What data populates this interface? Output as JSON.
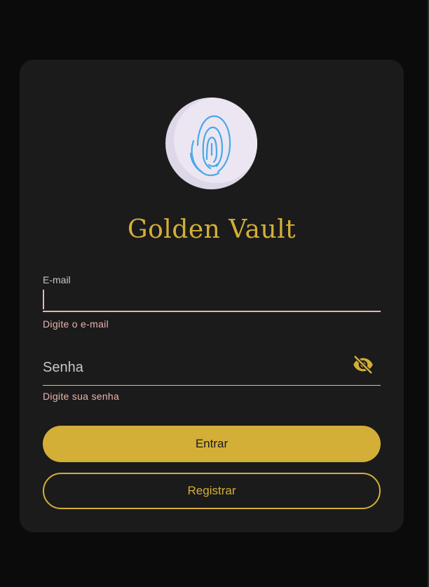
{
  "app": {
    "title": "Golden Vault",
    "logo_icon": "fingerprint-icon"
  },
  "form": {
    "email": {
      "label": "E-mail",
      "value": "",
      "error": "Digite o e-mail"
    },
    "password": {
      "placeholder": "Senha",
      "value": "",
      "error": "Digite sua senha",
      "toggle_icon": "eye-off-icon"
    },
    "login_button": "Entrar",
    "register_button": "Registrar"
  },
  "colors": {
    "accent": "#d4af37",
    "background": "#0b0b0b",
    "card": "#1b1b1b",
    "error": "#eab4ac",
    "fingerprint": "#4aa8e8"
  }
}
